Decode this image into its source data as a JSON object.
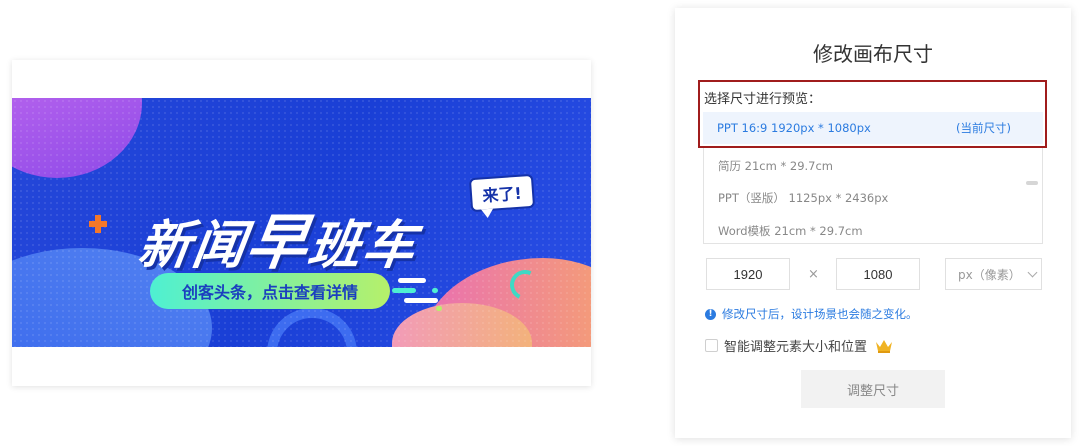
{
  "canvas_preview": {
    "headline_part1": "新闻",
    "headline_part2": "早",
    "headline_part3": "班车",
    "bubble_text": "来了!",
    "subtitle": "创客头条，点击查看详情"
  },
  "panel": {
    "title": "修改画布尺寸",
    "section_label": "选择尺寸进行预览：",
    "current_option": {
      "label": "PPT 16:9 1920px * 1080px",
      "tag": "(当前尺寸)"
    },
    "options": [
      {
        "label": "简历 21cm * 29.7cm"
      },
      {
        "label": "PPT（竖版） 1125px * 2436px"
      },
      {
        "label": "Word模板 21cm * 29.7cm"
      }
    ],
    "width_value": "1920",
    "times_symbol": "×",
    "height_value": "1080",
    "unit_select": "px（像素）",
    "notice": "修改尺寸后，设计场景也会随之变化。",
    "checkbox_label": "智能调整元素大小和位置",
    "submit_label": "调整尺寸"
  },
  "colors": {
    "accent_blue": "#2b7be0",
    "highlight_border": "#a01c1c",
    "banner_blue": "#1a3fd6",
    "crown": "#f0b323"
  },
  "icons": [
    "info-icon",
    "crown-icon",
    "chevron-down-icon",
    "plus-decoration-icon"
  ]
}
